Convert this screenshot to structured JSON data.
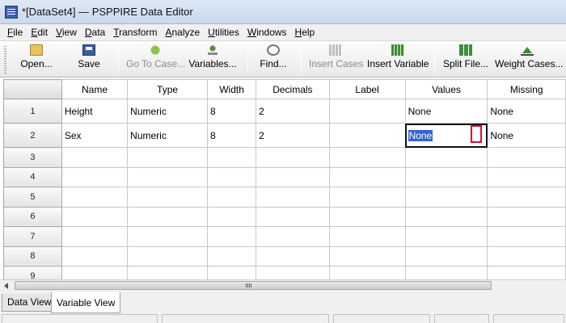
{
  "window": {
    "title": "*[DataSet4] — PSPPIRE Data Editor"
  },
  "menu": [
    "File",
    "Edit",
    "View",
    "Data",
    "Transform",
    "Analyze",
    "Utilities",
    "Windows",
    "Help"
  ],
  "toolbar": {
    "open": "Open...",
    "save": "Save",
    "goto_case": "Go To Case...",
    "variables": "Variables...",
    "find": "Find...",
    "insert_cases": "Insert Cases",
    "insert_variable": "Insert Variable",
    "split_file": "Split File...",
    "weight_cases": "Weight Cases..."
  },
  "grid": {
    "columns": [
      "Name",
      "Type",
      "Width",
      "Decimals",
      "Label",
      "Values",
      "Missing"
    ],
    "rows": [
      {
        "num": "1",
        "name": "Height",
        "type": "Numeric",
        "width": "8",
        "decimals": "2",
        "label": "",
        "values": "None",
        "missing": "None"
      },
      {
        "num": "2",
        "name": "Sex",
        "type": "Numeric",
        "width": "8",
        "decimals": "2",
        "label": "",
        "values": "None",
        "missing": "None"
      },
      {
        "num": "3"
      },
      {
        "num": "4"
      },
      {
        "num": "5"
      },
      {
        "num": "6"
      },
      {
        "num": "7"
      },
      {
        "num": "8"
      },
      {
        "num": "9"
      }
    ]
  },
  "tabs": {
    "data_view": "Data View",
    "variable_view": "Variable View"
  }
}
